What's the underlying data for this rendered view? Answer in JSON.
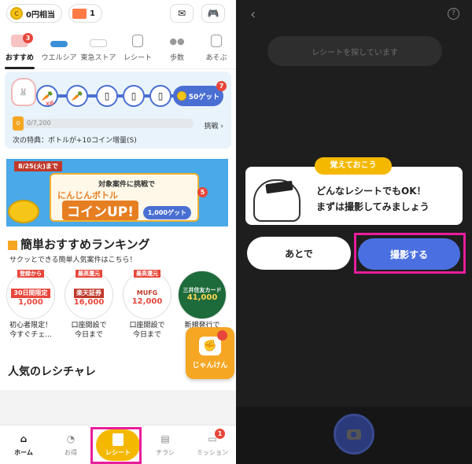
{
  "left": {
    "topbar": {
      "coins_label": "0円相当",
      "tickets": "1"
    },
    "tabs": [
      {
        "label": "おすすめ",
        "badge": "3"
      },
      {
        "label": "ウエルシア",
        "badge": ""
      },
      {
        "label": "東急ストア",
        "badge": ""
      },
      {
        "label": "レシート",
        "badge": ""
      },
      {
        "label": "歩数",
        "badge": ""
      },
      {
        "label": "あそぶ",
        "badge": ""
      }
    ],
    "bottle": {
      "multiplier": "x6",
      "get_label": "50ゲット",
      "get_badge": "7",
      "level": "0",
      "progress_text": "0/7,200",
      "progress": 0,
      "challenge": "挑戦 ›",
      "perk": "次の特典：ボトルが+10コイン増量(S)"
    },
    "banner": {
      "date": "8/25(火)まで",
      "line1": "対象案件に挑戦で",
      "line2": "にんじんボトル",
      "line3": "コインUP!",
      "get": "1,000ゲット",
      "badge": "5"
    },
    "ranking": {
      "title": "簡単おすすめランキング",
      "subtitle": "サクッとできる簡単人気案件はこちら！",
      "items": [
        {
          "tag": "登録から",
          "mid": "30日間限定",
          "amount": "1,000",
          "caption1": "初心者限定！",
          "caption2": "今すぐチェ..."
        },
        {
          "tag": "最高還元",
          "mid": "楽天証券",
          "amount": "16,000",
          "caption1": "口座開設で",
          "caption2": "今日まで"
        },
        {
          "tag": "最高還元",
          "mid": "MUFG",
          "amount": "12,000",
          "caption1": "口座開設で",
          "caption2": "今日まで"
        },
        {
          "tag": "",
          "mid": "三井住友カード",
          "amount": "41,000",
          "caption1": "新規発行で",
          "caption2": ""
        }
      ]
    },
    "janken": "じゃんけん",
    "popular": "人気のレシチャレ",
    "bottom_nav": [
      {
        "label": "ホーム"
      },
      {
        "label": "お得"
      },
      {
        "label": "レシート"
      },
      {
        "label": "チラシ"
      },
      {
        "label": "ミッション",
        "badge": "1"
      }
    ]
  },
  "right": {
    "searching": "レシートを探しています",
    "tip_tag": "覚えておこう",
    "message1": "どんなレシートでもOK！",
    "message2": "まずは撮影してみましょう",
    "later_button": "あとで",
    "shoot_button": "撮影する"
  },
  "colors": {
    "accent_blue": "#4a6fe0",
    "highlight": "#e81d9c",
    "yellow": "#f5b800"
  }
}
